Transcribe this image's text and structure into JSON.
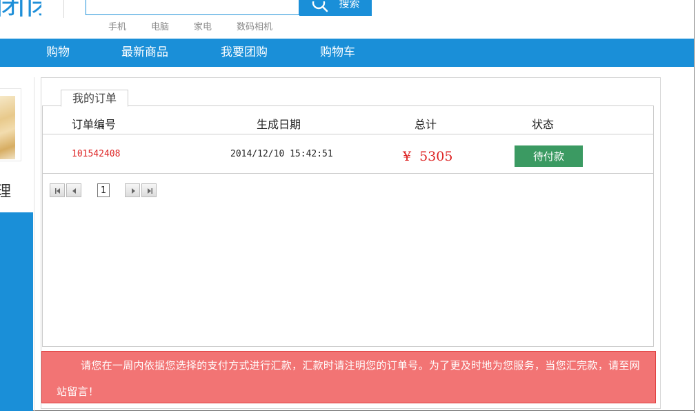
{
  "header": {
    "logo_text": "团团",
    "search": {
      "value": "",
      "placeholder": "",
      "button_label": "搜索"
    },
    "hot_words": [
      "手机",
      "电脑",
      "家电",
      "数码相机"
    ]
  },
  "nav": {
    "items": [
      "购物",
      "最新商品",
      "我要团购",
      "购物车"
    ]
  },
  "sidebar": {
    "glyph": "理"
  },
  "orders": {
    "tab_label": "我的订单",
    "columns": [
      "订单编号",
      "生成日期",
      "总计",
      "状态"
    ],
    "rows": [
      {
        "number": "101542408",
        "date": "2014/12/10 15:42:51",
        "currency": "¥",
        "total": "5305",
        "status": "待付款"
      }
    ],
    "pager": {
      "current_page": "1"
    }
  },
  "notice": {
    "text": "请您在一周内依据您选择的支付方式进行汇款，汇款时请注明您的订单号。为了更及时地为您服务，当您汇完款，请至网站留言！"
  },
  "colors": {
    "brand_blue": "#1a8fd8",
    "price_red": "#dd2222",
    "status_green": "#3b9a62",
    "notice_red": "#f27474"
  }
}
